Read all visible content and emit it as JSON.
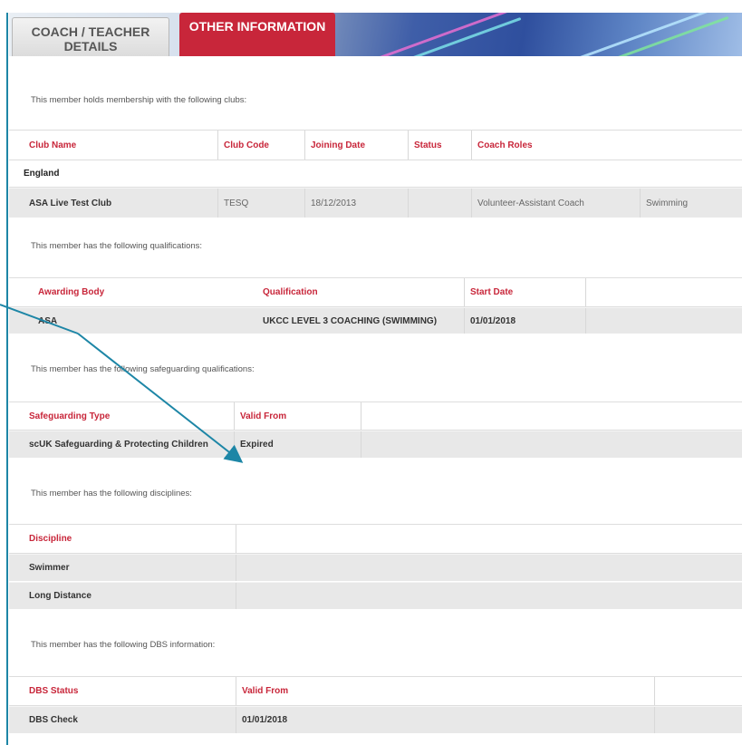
{
  "tabs": {
    "coach_label_line1": "COACH / TEACHER",
    "coach_label_line2": "DETAILS",
    "other_label": "OTHER INFORMATION"
  },
  "clubs": {
    "intro": "This member holds membership with the following clubs:",
    "headers": [
      "Club Name",
      "Club Code",
      "Joining Date",
      "Status",
      "Coach Roles"
    ],
    "region": "England",
    "row": {
      "club_name": "ASA Live Test Club",
      "club_code": "TESQ",
      "joining_date": "18/12/2013",
      "status": "",
      "coach_role": "Volunteer-Assistant Coach",
      "discipline": "Swimming"
    }
  },
  "qualifications": {
    "intro": "This member has the following qualifications:",
    "headers": [
      "Awarding Body",
      "Qualification",
      "Start Date"
    ],
    "row": {
      "awarding_body": "ASA",
      "qualification": "UKCC LEVEL 3 COACHING (SWIMMING)",
      "start_date": "01/01/2018"
    }
  },
  "safeguarding": {
    "intro": "This member has the following safeguarding qualifications:",
    "headers": [
      "Safeguarding Type",
      "Valid From"
    ],
    "row": {
      "type": "scUK Safeguarding & Protecting Children",
      "valid_from": "Expired"
    }
  },
  "disciplines": {
    "intro": "This member has the following disciplines:",
    "header": "Discipline",
    "rows": [
      "Swimmer",
      "Long Distance"
    ]
  },
  "dbs": {
    "intro": "This member has the following DBS information:",
    "headers": [
      "DBS Status",
      "Valid From"
    ],
    "row": {
      "status": "DBS Check",
      "valid_from": "01/01/2018"
    }
  },
  "colors": {
    "accent": "#c8263a",
    "arrow": "#1d86a6",
    "row_gray": "#e8e8e8"
  },
  "annotation": {
    "icon": "arrow-icon"
  }
}
